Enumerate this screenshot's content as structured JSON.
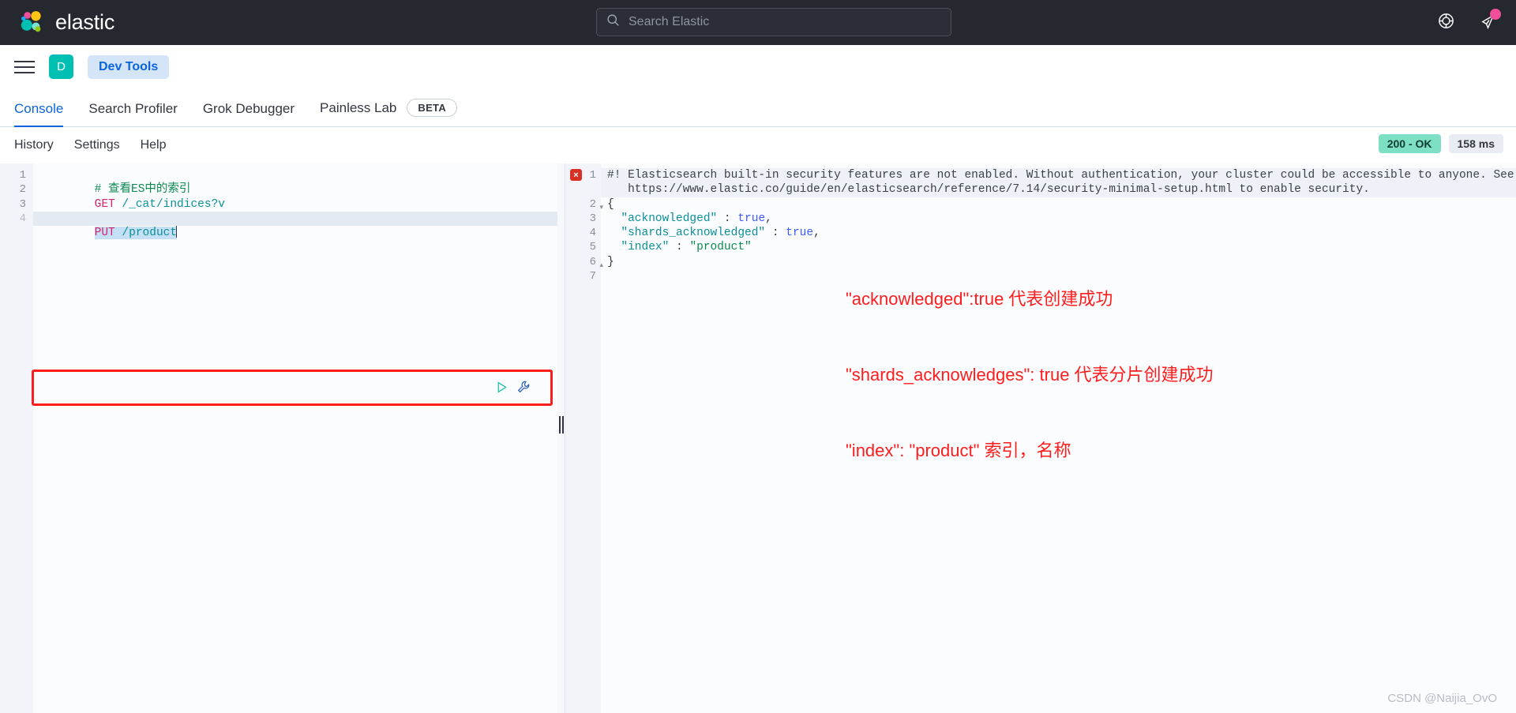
{
  "header": {
    "brand": "elastic",
    "logo_icon": "elastic-logo",
    "search": {
      "placeholder": "Search Elastic",
      "value": "",
      "icon": "search-icon"
    },
    "help_icon": "help-circle-icon",
    "announcements_icon": "announcement-megaphone-icon",
    "notification_badge_color": "#f04e98"
  },
  "breadcrumb": {
    "menu_icon": "hamburger-menu-icon",
    "space_initial": "D",
    "space_color": "#00bfb3",
    "current": "Dev Tools"
  },
  "app_tabs": [
    {
      "label": "Console",
      "active": true
    },
    {
      "label": "Search Profiler",
      "active": false
    },
    {
      "label": "Grok Debugger",
      "active": false
    },
    {
      "label": "Painless Lab",
      "active": false,
      "badge": "BETA"
    }
  ],
  "console_toolbar": {
    "links": [
      "History",
      "Settings",
      "Help"
    ],
    "status_code": "200 - OK",
    "status_color": "#7ddfc3",
    "duration": "158 ms"
  },
  "editor": {
    "line_numbers": [
      "1",
      "2",
      "3",
      "4"
    ],
    "lines": [
      {
        "comment": "# 查看ES中的索引"
      },
      {
        "method": "GET",
        "url": " /_cat/indices?v"
      },
      {
        "blank": ""
      },
      {
        "method": "PUT",
        "url": " /product",
        "active": true
      }
    ],
    "play_icon": "play-request-icon",
    "wrench_icon": "wrench-actions-icon",
    "highlight_color": "#fc1d1d"
  },
  "splitter": {
    "grip_icon": "resize-grip-icon"
  },
  "response": {
    "line_numbers": [
      "1",
      "",
      "2",
      "3",
      "4",
      "5",
      "6",
      "7"
    ],
    "error_marker": "×",
    "warning_line_1": "#! Elasticsearch built-in security features are not enabled. Without authentication, your cluster could be accessible to anyone. See",
    "warning_line_2": "   https://www.elastic.co/guide/en/elasticsearch/reference/7.14/security-minimal-setup.html to enable security.",
    "json": {
      "open_brace": "{",
      "rows": [
        {
          "key": "\"acknowledged\"",
          "sep": " : ",
          "value": "true",
          "type": "bool",
          "comma": ","
        },
        {
          "key": "\"shards_acknowledged\"",
          "sep": " : ",
          "value": "true",
          "type": "bool",
          "comma": ","
        },
        {
          "key": "\"index\"",
          "sep": " : ",
          "value": "\"product\"",
          "type": "string",
          "comma": ""
        }
      ],
      "close_brace": "}"
    }
  },
  "annotations": {
    "color": "#fe1d1d",
    "lines": [
      "\"acknowledged\":true 代表创建成功",
      "\"shards_acknowledges\": true 代表分片创建成功",
      "\"index\": \"product\" 索引，名称"
    ]
  },
  "watermark": "CSDN @Naijia_OvO"
}
